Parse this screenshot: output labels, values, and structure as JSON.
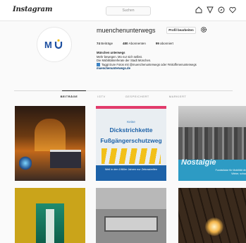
{
  "app": {
    "logo": "Instagram"
  },
  "search": {
    "placeholder": "Suchen"
  },
  "nav": {
    "icons": [
      "home-icon",
      "direct-icon",
      "explore-icon",
      "heart-icon"
    ]
  },
  "profile": {
    "username": "muenchenunterwegs",
    "edit_label": "Profil bearbeiten",
    "stats": {
      "posts": "74",
      "posts_label": "Beiträge",
      "followers": "480",
      "followers_label": "Abonnenten",
      "following": "99",
      "following_label": "abonniert"
    },
    "bio": {
      "name": "München unterwegs",
      "line1": "Mehr bewegen. Mo nur sich selbst.",
      "line2": "Die Mobilitätsreferate der Stadt München.",
      "line3": "Taggt Eure Fotos mit @muenchenunterwegs oder #mitoffenenunterwegs",
      "link": "muenchenunterwegs.de"
    }
  },
  "tabs": [
    {
      "label": "BEITRÄGE"
    },
    {
      "label": "IGTV"
    },
    {
      "label": "GESPEICHERT"
    },
    {
      "label": "MARKIERT"
    }
  ],
  "posts": {
    "tile2": {
      "line1": "Keine",
      "line2": "Dickstrichkette",
      "line3": "Fußgängerschutzweg",
      "foot": "Weil in den 1960er Jahren nur Zebrastreifen"
    },
    "tile3": {
      "title": "Nostalgie",
      "caption": "Fundstücke für Mobilität der Winter, schau"
    }
  },
  "colors": {
    "accent": "#1d62a8",
    "link": "#00376b",
    "border": "#dbdbdb",
    "yellow": "#f2c01a"
  }
}
